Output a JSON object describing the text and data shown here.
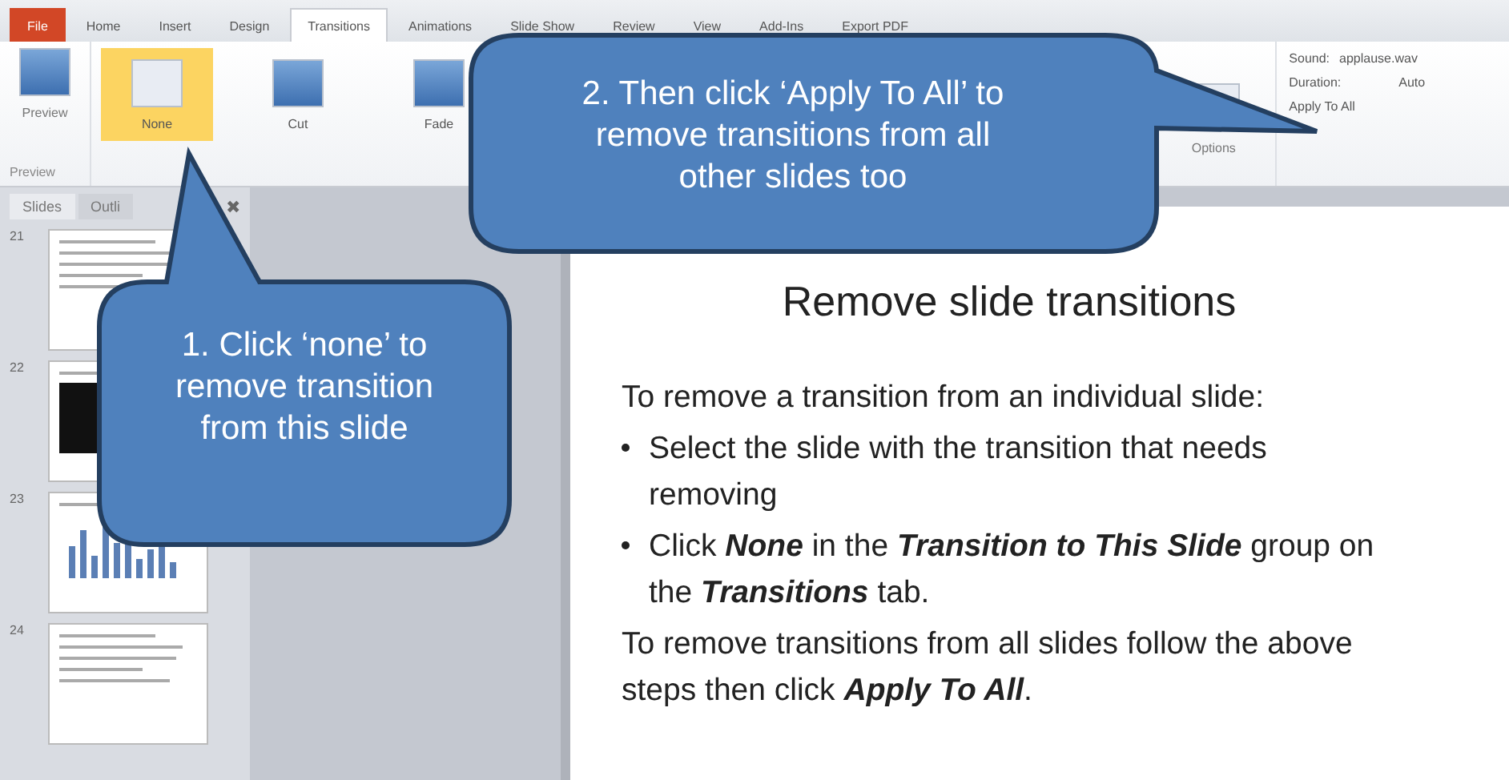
{
  "ribbon_tabs": [
    {
      "label": "File",
      "kind": "file",
      "selected": false
    },
    {
      "label": "Home",
      "kind": "tab",
      "selected": false
    },
    {
      "label": "Insert",
      "kind": "tab",
      "selected": false
    },
    {
      "label": "Design",
      "kind": "tab",
      "selected": false
    },
    {
      "label": "Transitions",
      "kind": "tab",
      "selected": true
    },
    {
      "label": "Animations",
      "kind": "tab",
      "selected": false
    },
    {
      "label": "Slide Show",
      "kind": "tab",
      "selected": false
    },
    {
      "label": "Review",
      "kind": "tab",
      "selected": false
    },
    {
      "label": "View",
      "kind": "tab",
      "selected": false
    },
    {
      "label": "Add-Ins",
      "kind": "tab",
      "selected": false
    },
    {
      "label": "Export PDF",
      "kind": "tab",
      "selected": false
    }
  ],
  "ribbon": {
    "preview": {
      "label": "Preview",
      "group_label": "Preview"
    },
    "transitions": [
      {
        "label": "None",
        "selected": true
      },
      {
        "label": "Cut",
        "selected": false
      },
      {
        "label": "Fade",
        "selected": false
      }
    ],
    "effect_options": "Options",
    "timing": {
      "sound_label": "Sound:",
      "sound_value": "applause.wav",
      "duration_label": "Duration:",
      "duration_value": "Auto",
      "apply_all": "Apply To All"
    }
  },
  "slides_pane": {
    "tabs": [
      {
        "label": "Slides",
        "selected": true
      },
      {
        "label": "Outli",
        "selected": false
      }
    ],
    "close": "✖",
    "slides": [
      {
        "number": "21",
        "kind": "text"
      },
      {
        "number": "22",
        "kind": "photo"
      },
      {
        "number": "23",
        "kind": "chart"
      },
      {
        "number": "24",
        "kind": "text"
      }
    ]
  },
  "slide": {
    "title": "Remove slide transitions",
    "intro": "To remove a transition from an individual slide:",
    "bullets": [
      "Select the slide with the transition that needs removing",
      "Click **None** in the **Transition to This Slide** group on the **Transitions** tab."
    ],
    "outro": "To remove transitions from all slides follow the above steps then click **Apply To All**."
  },
  "callouts": [
    "1. Click ‘none’ to remove transition from this slide",
    "2. Then click ‘Apply To All’ to remove transitions from all other slides too"
  ]
}
